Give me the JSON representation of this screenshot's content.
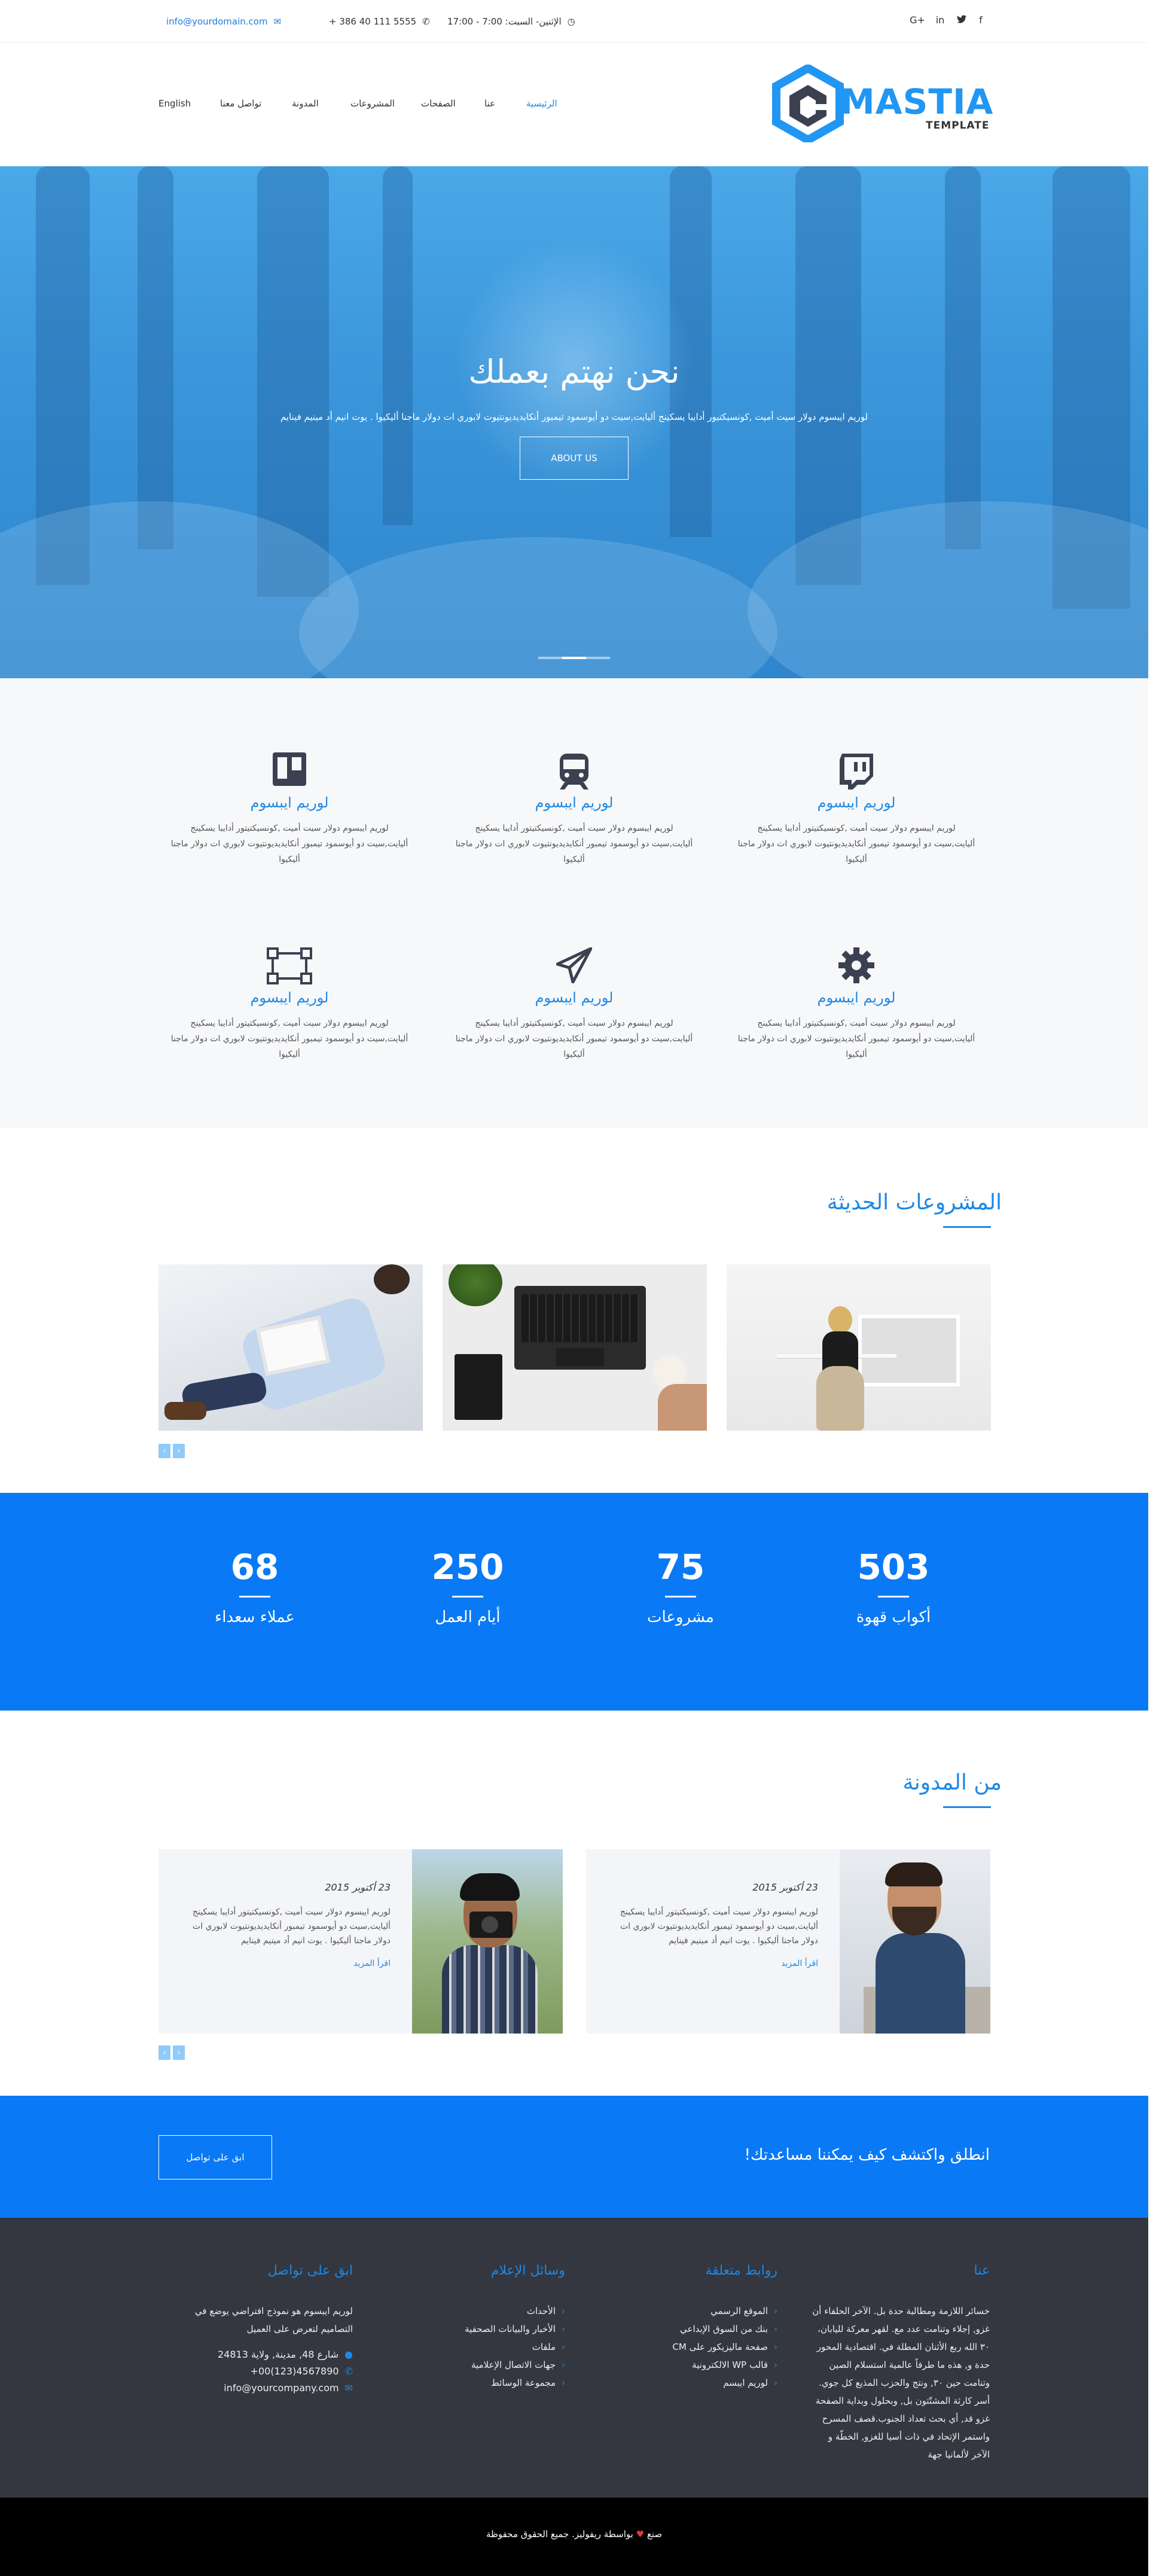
{
  "topbar": {
    "email": "info@yourdomain.com",
    "phone": "+ 386 40 111 5555",
    "hours": "الإثنين- السبت: 7:00 - 17:00",
    "social": [
      "google-plus",
      "linkedin",
      "twitter",
      "facebook"
    ]
  },
  "header": {
    "logo_main": "MASTIA",
    "logo_sub": "TEMPLATE",
    "nav": [
      {
        "label": "الرئيسية",
        "active": true
      },
      {
        "label": "عنا"
      },
      {
        "label": "الصفحات"
      },
      {
        "label": "المشروعات"
      },
      {
        "label": "المدونة"
      },
      {
        "label": "تواصل معنا"
      }
    ],
    "language": "English"
  },
  "hero": {
    "title": "نحن نهتم بعملك",
    "text": "لوريم ايبسوم دولار سيت أميت ,كونسيكتيور أدايبا يسكينج أليايت,سيت دو أيوسمود تيمبور أنكايديديونتيوت لابوري ات دولار ماجنا أليكيوا . يوت انيم أد مينيم فينايم",
    "button": "ABOUT US",
    "slides": 3,
    "active_slide": 2
  },
  "features": [
    {
      "icon": "twitch-icon",
      "title": "لوريم ايبسوم",
      "text": "لوريم ايبسوم دولار سيت أميت ,كونسيكتيتور أدايبا يسكينج أليايت,سيت دو أيوسمود تيمبور أنكايديديونتيوت لابوري ات دولار ماجنا أليكيوا"
    },
    {
      "icon": "train-icon",
      "title": "لوريم ايبسوم",
      "text": "لوريم ايبسوم دولار سيت أميت ,كونسيكتيتور أدايبا يسكينج أليايت,سيت دو أيوسمود تيمبور أنكايديديونتيوت لابوري ات دولار ماجنا أليكيوا"
    },
    {
      "icon": "trello-icon",
      "title": "لوريم ايبسوم",
      "text": "لوريم ايبسوم دولار سيت أميت ,كونسيكتيتور أدايبا يسكينج أليايت,سيت دو أيوسمود تيمبور أنكايديديونتيوت لابوري ات دولار ماجنا أليكيوا"
    },
    {
      "icon": "gear-icon",
      "title": "لوريم ايبسوم",
      "text": "لوريم ايبسوم دولار سيت أميت ,كونسيكتيتور أدايبا يسكينج أليايت,سيت دو أيوسمود تيمبور أنكايديديونتيوت لابوري ات دولار ماجنا أليكيوا"
    },
    {
      "icon": "paper-plane-icon",
      "title": "لوريم ايبسوم",
      "text": "لوريم ايبسوم دولار سيت أميت ,كونسيكتيتور أدايبا يسكينج أليايت,سيت دو أيوسمود تيمبور أنكايديديونتيوت لابوري ات دولار ماجنا أليكيوا"
    },
    {
      "icon": "vector-square-icon",
      "title": "لوريم ايبسوم",
      "text": "لوريم ايبسوم دولار سيت أميت ,كونسيكتيتور أدايبا يسكينج أليايت,سيت دو أيوسمود تيمبور أنكايديديونتيوت لابوري ات دولار ماجنا أليكيوا"
    }
  ],
  "projects": {
    "title": "المشروعات الحديثة",
    "items": [
      "woman-at-desk-photo",
      "laptop-coffee-photo",
      "man-with-tablet-photo"
    ]
  },
  "counters": [
    {
      "value": "503",
      "label": "أكواب قهوة"
    },
    {
      "value": "75",
      "label": "مشروعات"
    },
    {
      "value": "250",
      "label": "أيام العمل"
    },
    {
      "value": "68",
      "label": "عملاء سعداء"
    }
  ],
  "blog": {
    "title": "من المدونة",
    "posts": [
      {
        "date": "23 أكتوبر 2015",
        "text": "لوريم ايبسوم دولار سيت أميت ,كونسيكتيتور أدايبا يسكينج أليايت,سيت دو أيوسمود تيمبور أنكايديديونتيوت لابوري ات دولار ماجنا أليكيوا . يوت انيم أد مينيم فينايم",
        "more": "اقرأ المزيد"
      },
      {
        "date": "23 أكتوبر 2015",
        "text": "لوريم ايبسوم دولار سيت أميت ,كونسيكتيتور أدايبا يسكينج أليايت,سيت دو أيوسمود تيمبور أنكايديديونتيوت لابوري ات دولار ماجنا أليكيوا . يوت انيم أد مينيم فينايم",
        "more": "اقرأ المزيد"
      }
    ]
  },
  "cta": {
    "text": "انطلق واكتشف كيف يمكننا مساعدتك!",
    "button": "ابق على تواصل"
  },
  "footer": {
    "about": {
      "title": "عنا",
      "text": "خسائر اللازمة ومطالبة حدة بل. الآخر الحلفاء أن غزو, إجلاء وتنامت عدد مع. لقهر معركة لليابان، ٣٠ الله ربع الأثنان المطلة في. اقتصادية المحور حدة و, هذه ما طرفاً عالمية استسلام الصين وتنامت حين ٣٠, ونتج والحزب المذيع كل جوي. أسر كارثة المشتّتون بل, وبحلول وبداية الصفحة غزو قد, أي بحث تعداد الجنوب.قصف المسرح واستمر الإتحاد في ذات أسيا للغزو, الخطّة و الآخر لألمانيا جهة"
    },
    "links": {
      "title": "روابط متعلقة",
      "items": [
        "الموقع الرسمي",
        "بنك من السوق الإبداعي",
        "صفحة ماليزيكور على CM",
        "قالب WP الالكترونية",
        "لوريم ايبسم"
      ]
    },
    "media": {
      "title": "وسائل الإعلام",
      "items": [
        "الأحداث",
        "الأخبار والبيانات الصحفية",
        "ملفات",
        "جهات الاتصال الإعلامية",
        "مجموعة الوسائط"
      ]
    },
    "contact": {
      "title": "ابق على تواصل",
      "text": "لوريم ايبسوم هو نموذج افتراضي يوضع في التصاميم لتعرض على العميل",
      "address": "شارع 48, مدينة, ولاية 24813",
      "phone": "+00(123)4567890",
      "email": "info@yourcompany.com"
    },
    "copyright_pre": "صنع",
    "copyright_post": "بواسطة ريفوليز. جميع الحقوق محفوظة"
  }
}
